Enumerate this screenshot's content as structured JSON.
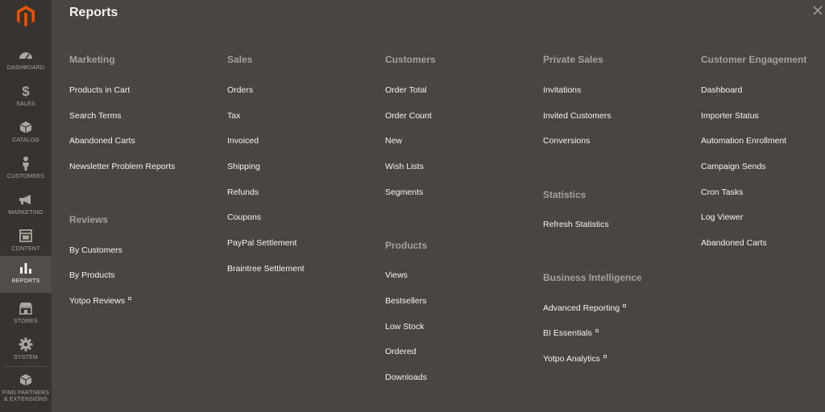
{
  "sidebar": {
    "items": [
      {
        "label": "DASHBOARD",
        "icon": "speedometer-icon"
      },
      {
        "label": "SALES",
        "icon": "dollar-icon"
      },
      {
        "label": "CATALOG",
        "icon": "box-icon"
      },
      {
        "label": "CUSTOMERS",
        "icon": "person-icon"
      },
      {
        "label": "MARKETING",
        "icon": "megaphone-icon"
      },
      {
        "label": "CONTENT",
        "icon": "layout-icon"
      },
      {
        "label": "REPORTS",
        "icon": "bar-chart-icon"
      },
      {
        "label": "STORES",
        "icon": "storefront-icon"
      },
      {
        "label": "SYSTEM",
        "icon": "gear-icon"
      },
      {
        "label": "FIND PARTNERS & EXTENSIONS",
        "icon": "puzzle-box-icon"
      }
    ],
    "active": "REPORTS"
  },
  "panel": {
    "title": "Reports"
  },
  "columns": [
    {
      "sections": [
        {
          "title": "Marketing",
          "links": [
            "Products in Cart",
            "Search Terms",
            "Abandoned Carts",
            "Newsletter Problem Reports"
          ]
        },
        {
          "title": "Reviews",
          "links": [
            "By Customers",
            "By Products",
            "Yotpo Reviews"
          ]
        }
      ]
    },
    {
      "sections": [
        {
          "title": "Sales",
          "links": [
            "Orders",
            "Tax",
            "Invoiced",
            "Shipping",
            "Refunds",
            "Coupons",
            "PayPal Settlement",
            "Braintree Settlement"
          ]
        }
      ]
    },
    {
      "sections": [
        {
          "title": "Customers",
          "links": [
            "Order Total",
            "Order Count",
            "New",
            "Wish Lists",
            "Segments"
          ]
        },
        {
          "title": "Products",
          "links": [
            "Views",
            "Bestsellers",
            "Low Stock",
            "Ordered",
            "Downloads"
          ]
        }
      ]
    },
    {
      "sections": [
        {
          "title": "Private Sales",
          "links": [
            "Invitations",
            "Invited Customers",
            "Conversions"
          ]
        },
        {
          "title": "Statistics",
          "links": [
            "Refresh Statistics"
          ]
        },
        {
          "title": "Business Intelligence",
          "links": [
            "Advanced Reporting",
            "BI Essentials",
            "Yotpo Analytics"
          ]
        }
      ]
    },
    {
      "sections": [
        {
          "title": "Customer Engagement",
          "links": [
            "Dashboard",
            "Importer Status",
            "Automation Enrollment",
            "Campaign Sends",
            "Cron Tasks",
            "Log Viewer",
            "Abandoned Carts"
          ]
        }
      ]
    }
  ],
  "external_link_marker": "external-link-icon",
  "colors": {
    "sidebar_bg": "#373330",
    "panel_bg": "#4a4542",
    "active_item_bg": "#524d49",
    "logo_orange": "#eb5202",
    "section_title": "#a6a19c",
    "link_text": "#f7f3eb"
  }
}
